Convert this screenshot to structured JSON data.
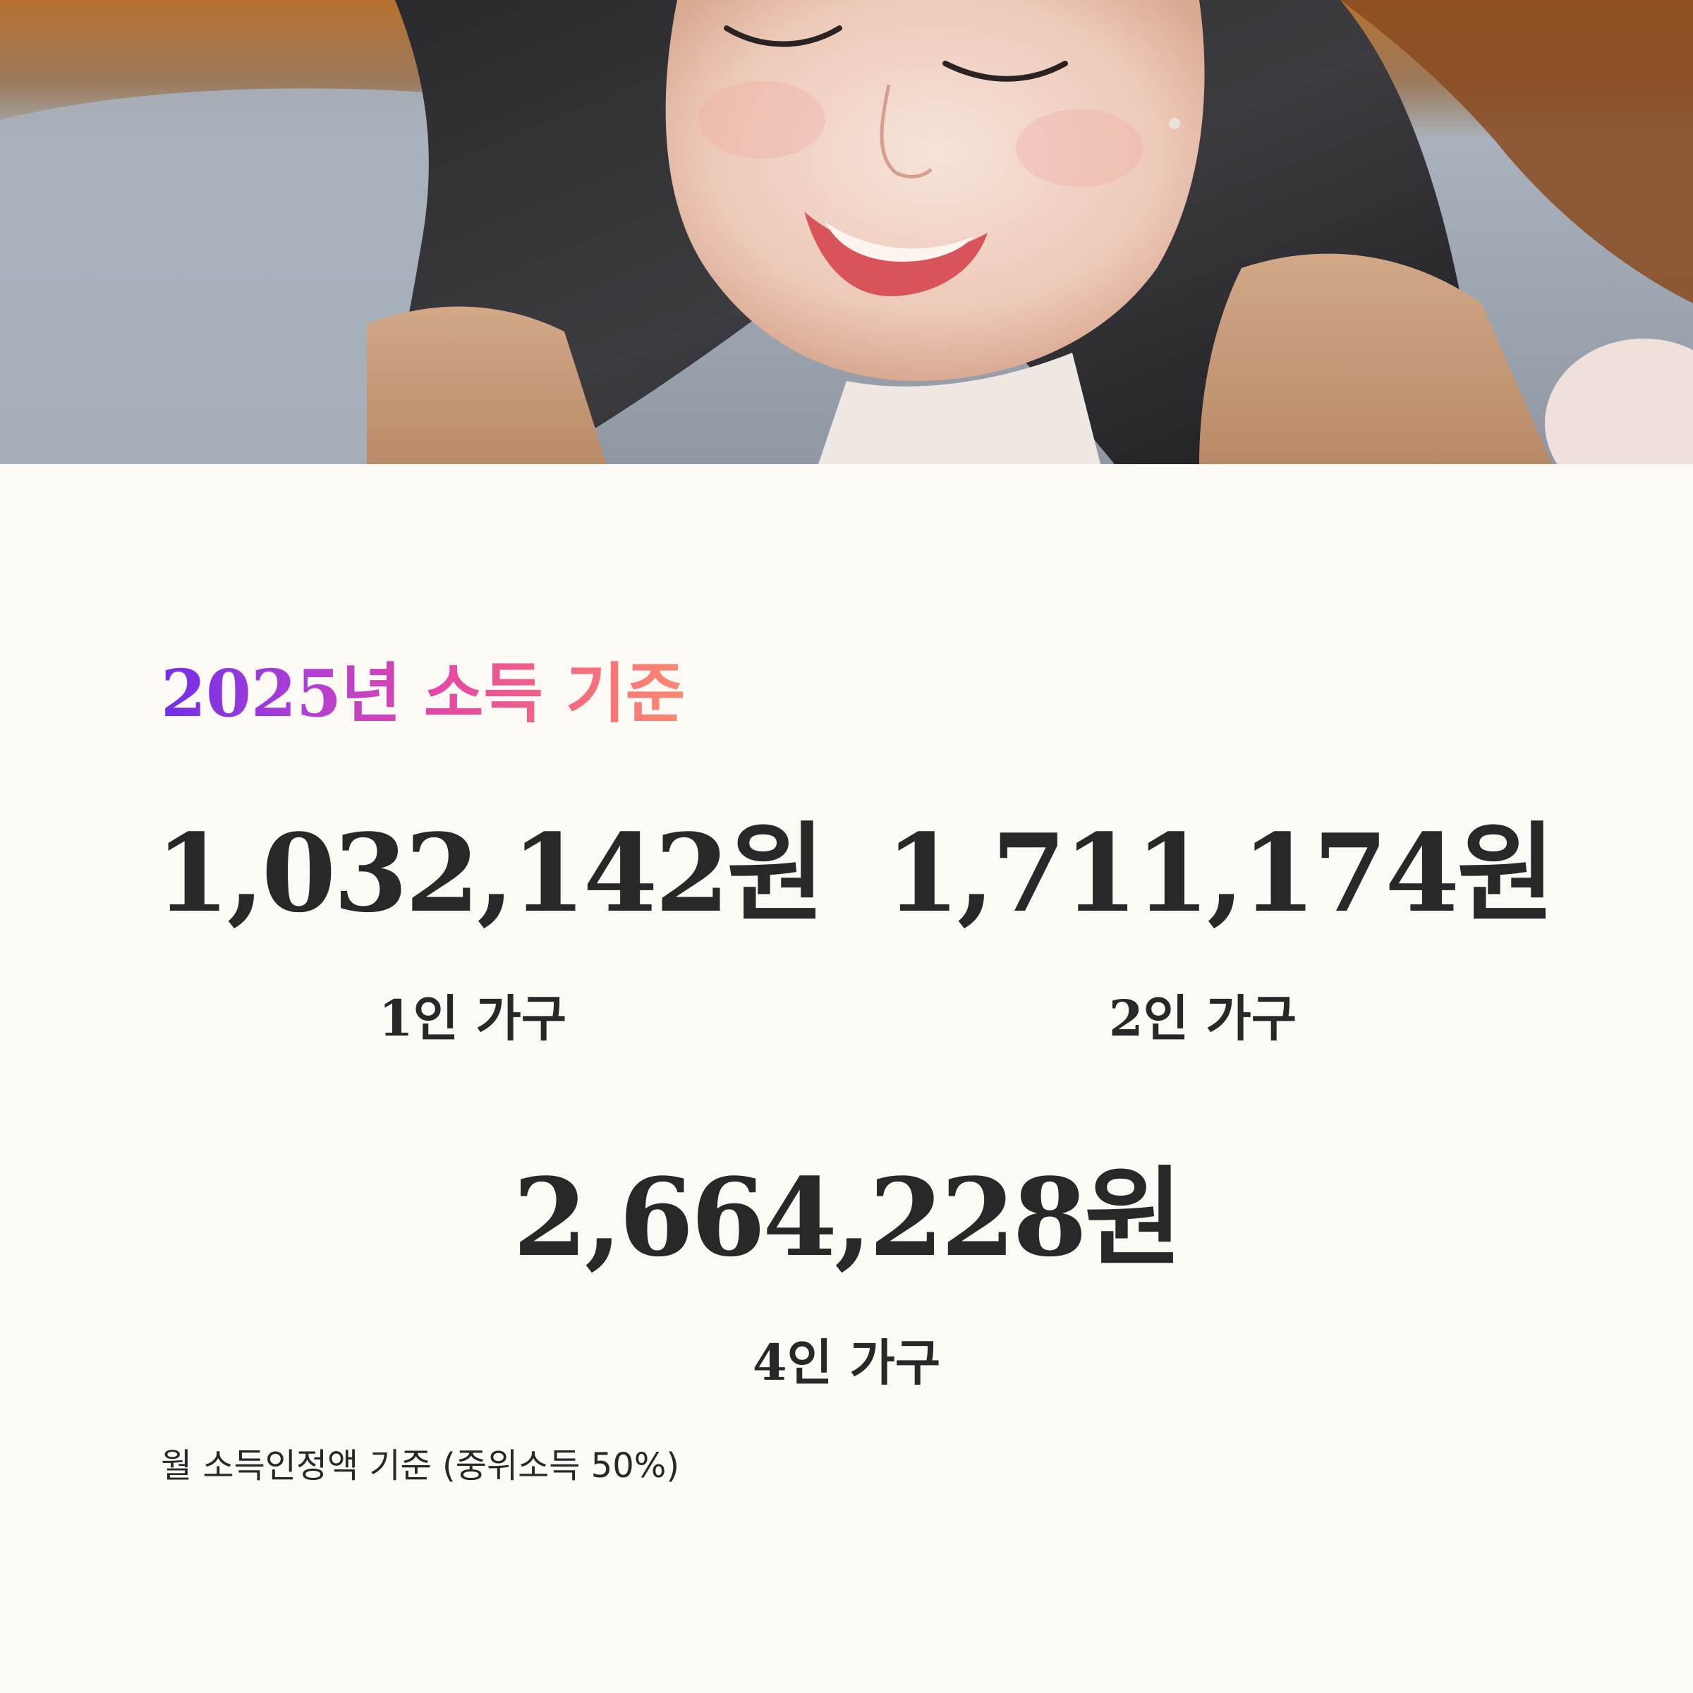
{
  "hero": {
    "image_alt": "photo-smiling-woman"
  },
  "heading": {
    "title": "2025년 소득 기준",
    "gradient_colors": [
      "#6e2fe8",
      "#b23ed4",
      "#e54aa1",
      "#f56d7d",
      "#fb8a6f"
    ]
  },
  "households": [
    {
      "amount": "1,032,142원",
      "label": "1인 가구"
    },
    {
      "amount": "1,711,174원",
      "label": "2인 가구"
    },
    {
      "amount": "2,664,228원",
      "label": "4인 가구"
    }
  ],
  "footnote": "월 소득인정액 기준 (중위소득 50%)",
  "colors": {
    "background": "#fdfaf6",
    "text": "#2a2728"
  }
}
